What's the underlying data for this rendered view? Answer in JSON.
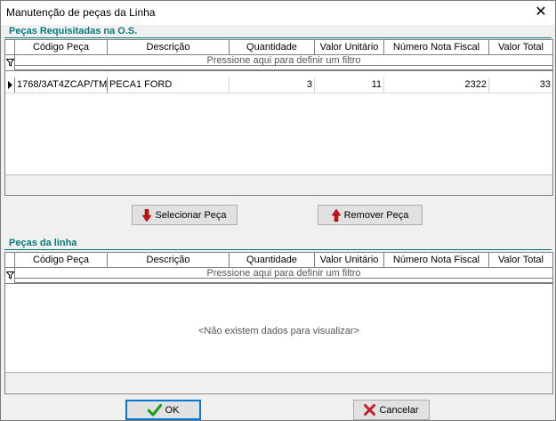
{
  "window": {
    "title": "Manutenção de peças da Linha",
    "close_glyph": "✕"
  },
  "requested": {
    "section_title": "Peças Requisitadas na O.S.",
    "columns": [
      "Código Peça",
      "Descrição",
      "Quantidade",
      "Valor Unitário",
      "Número Nota Fiscal",
      "Valor Total"
    ],
    "filter_text": "Pressione aqui para definir um filtro",
    "rows": [
      {
        "codigo": "1768/3AT4ZCAP/TM/",
        "descricao": "PECA1 FORD",
        "quantidade": "3",
        "valor_unitario": "11",
        "nota_fiscal": "2322",
        "valor_total": "33"
      }
    ]
  },
  "actions": {
    "select_label": "Selecionar Peça",
    "remove_label": "Remover Peça"
  },
  "line": {
    "section_title": "Peças da linha",
    "columns": [
      "Código Peça",
      "Descrição",
      "Quantidade",
      "Valor Unitário",
      "Número Nota Fiscal",
      "Valor Total"
    ],
    "filter_text": "Pressione aqui para definir um filtro",
    "empty_text": "<Não existem dados para visualizar>"
  },
  "footer": {
    "ok_label": "OK",
    "cancel_label": "Cancelar"
  },
  "colors": {
    "section_accent": "#0a7a7a",
    "arrow_red": "#d01010",
    "check_green": "#1a9a1a",
    "cancel_red": "#c0202a"
  },
  "icons": {
    "filter": "filter-icon",
    "row_pointer": "row-pointer-icon",
    "select": "arrow-down-icon",
    "remove": "arrow-up-icon",
    "ok": "checkmark-icon",
    "cancel": "x-icon"
  }
}
